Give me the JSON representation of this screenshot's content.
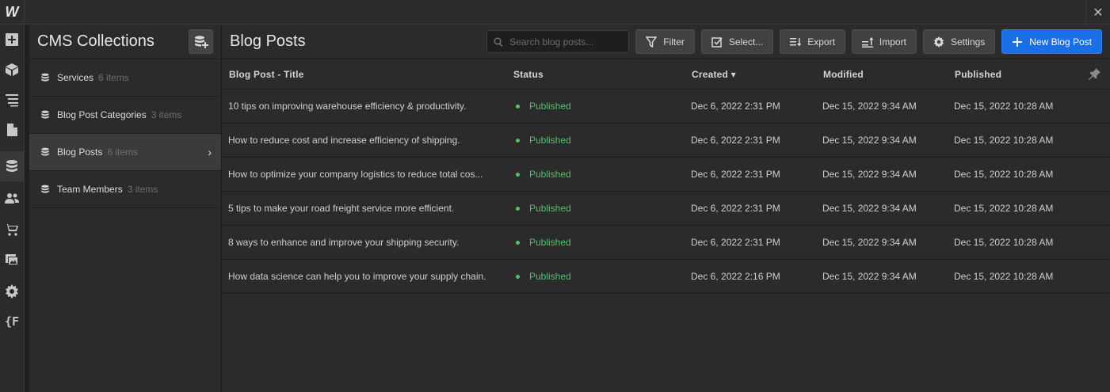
{
  "app": {
    "logo": "W",
    "close_glyph": "✕"
  },
  "rail": {
    "items": [
      {
        "icon": "add-panel-icon"
      },
      {
        "icon": "components-box-icon"
      },
      {
        "icon": "navigator-icon"
      },
      {
        "icon": "pages-icon"
      },
      {
        "icon": "cms-database-icon",
        "active": true
      },
      {
        "icon": "users-icon"
      },
      {
        "icon": "ecommerce-cart-icon"
      },
      {
        "icon": "assets-images-icon"
      },
      {
        "icon": "settings-gear-icon"
      },
      {
        "icon": "variables-icon",
        "label": "{F"
      }
    ]
  },
  "collections": {
    "title": "CMS Collections",
    "items": [
      {
        "name": "Services",
        "count": "6 items"
      },
      {
        "name": "Blog Post Categories",
        "count": "3 items"
      },
      {
        "name": "Blog Posts",
        "count": "6 items",
        "active": true,
        "chevron": "›"
      },
      {
        "name": "Team Members",
        "count": "3 items"
      }
    ]
  },
  "main": {
    "title": "Blog Posts",
    "search_placeholder": "Search blog posts...",
    "buttons": {
      "filter": "Filter",
      "select": "Select...",
      "export": "Export",
      "import": "Import",
      "settings": "Settings",
      "new_post": "New Blog Post"
    },
    "columns": {
      "title": "Blog Post - Title",
      "status": "Status",
      "created": "Created ▾",
      "modified": "Modified",
      "published": "Published"
    },
    "rows": [
      {
        "title": "10 tips on improving warehouse efficiency & productivity.",
        "status": "Published",
        "created": "Dec 6, 2022 2:31 PM",
        "modified": "Dec 15, 2022 9:34 AM",
        "published": "Dec 15, 2022 10:28 AM"
      },
      {
        "title": "How to reduce cost and increase efficiency of shipping.",
        "status": "Published",
        "created": "Dec 6, 2022 2:31 PM",
        "modified": "Dec 15, 2022 9:34 AM",
        "published": "Dec 15, 2022 10:28 AM"
      },
      {
        "title": "How to optimize your company logistics to reduce total cos...",
        "status": "Published",
        "created": "Dec 6, 2022 2:31 PM",
        "modified": "Dec 15, 2022 9:34 AM",
        "published": "Dec 15, 2022 10:28 AM"
      },
      {
        "title": "5 tips to make your road freight service more efficient.",
        "status": "Published",
        "created": "Dec 6, 2022 2:31 PM",
        "modified": "Dec 15, 2022 9:34 AM",
        "published": "Dec 15, 2022 10:28 AM"
      },
      {
        "title": "8 ways to enhance and improve your shipping security.",
        "status": "Published",
        "created": "Dec 6, 2022 2:31 PM",
        "modified": "Dec 15, 2022 9:34 AM",
        "published": "Dec 15, 2022 10:28 AM"
      },
      {
        "title": "How data science can help you to improve your supply chain.",
        "status": "Published",
        "created": "Dec 6, 2022 2:16 PM",
        "modified": "Dec 15, 2022 9:34 AM",
        "published": "Dec 15, 2022 10:28 AM"
      }
    ]
  },
  "colors": {
    "accent": "#1a6fe6",
    "status_published": "#4ec36c"
  }
}
